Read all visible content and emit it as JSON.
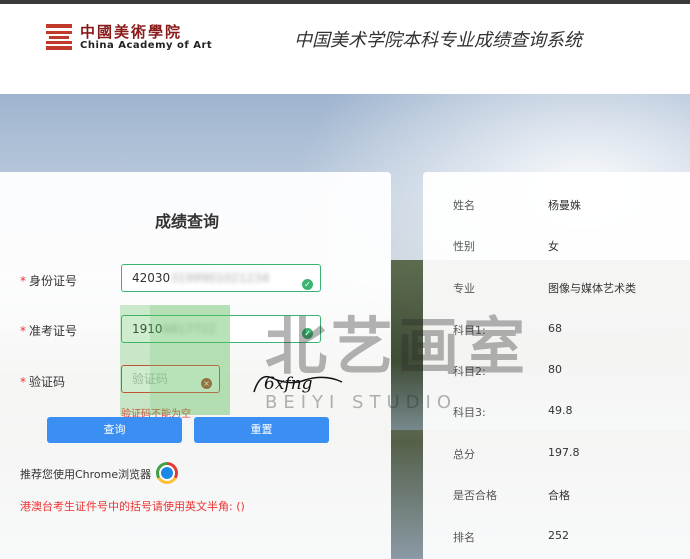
{
  "header": {
    "logo_cn": "中國美術學院",
    "logo_en": "China Academy of Art",
    "system_title": "中国美术学院本科专业成绩查询系统"
  },
  "form": {
    "title": "成绩查询",
    "required_mark": "*",
    "id_label": "身份证号",
    "id_value": "42030",
    "id_hidden": "3199901021234",
    "exam_label": "准考证号",
    "exam_value": "1910",
    "exam_hidden": "6817722",
    "captcha_label": "验证码",
    "captcha_placeholder": "验证码",
    "captcha_text": "6xfng",
    "captcha_error": "验证码不能为空",
    "query_button": "查询",
    "reset_button": "重置",
    "recommend_text": "推荐您使用Chrome浏览器",
    "notice_text": "港澳台考生证件号中的括号请使用英文半角: ()"
  },
  "result": {
    "rows": [
      {
        "label": "姓名",
        "value": "杨曼姝"
      },
      {
        "label": "性别",
        "value": "女"
      },
      {
        "label": "专业",
        "value": "图像与媒体艺术类"
      },
      {
        "label": "科目1:",
        "value": "68"
      },
      {
        "label": "科目2:",
        "value": "80"
      },
      {
        "label": "科目3:",
        "value": "49.8"
      },
      {
        "label": "总分",
        "value": "197.8"
      },
      {
        "label": "是否合格",
        "value": "合格"
      },
      {
        "label": "排名",
        "value": "252"
      }
    ]
  },
  "watermark": {
    "cn": "北艺画室",
    "en": "BEIYI STUDIO"
  },
  "colors": {
    "accent_blue": "#3b8ff2",
    "valid_green": "#3cb371",
    "error_red": "#e33333",
    "logo_red": "#8b1a1a"
  }
}
